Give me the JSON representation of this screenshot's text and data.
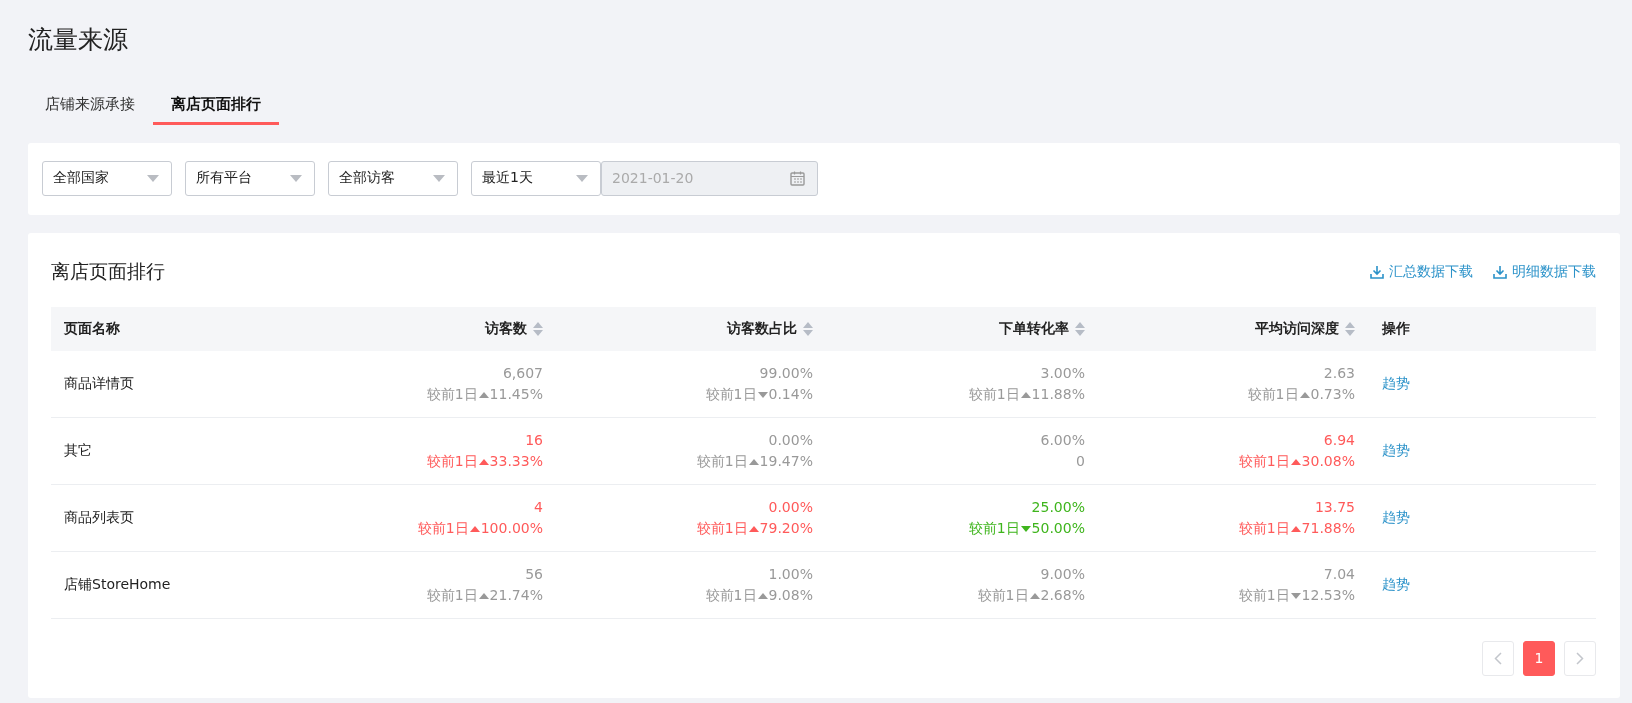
{
  "page_title": "流量来源",
  "tabs": [
    {
      "label": "店铺来源承接",
      "selected": false
    },
    {
      "label": "离店页面排行",
      "selected": true
    }
  ],
  "filters": [
    {
      "kind": "select",
      "value": "全部国家"
    },
    {
      "kind": "select",
      "value": "所有平台"
    },
    {
      "kind": "select",
      "value": "全部访客"
    },
    {
      "kind": "select",
      "value": "最近1天"
    },
    {
      "kind": "date",
      "value": "2021-01-20",
      "disabled": true
    }
  ],
  "ranking": {
    "title": "离店页面排行",
    "downloads": [
      "汇总数据下载",
      "明细数据下载"
    ],
    "columns": [
      {
        "label": "页面名称",
        "sortable": false
      },
      {
        "label": "访客数",
        "sortable": true
      },
      {
        "label": "访客数占比",
        "sortable": true
      },
      {
        "label": "下单转化率",
        "sortable": true
      },
      {
        "label": "平均访问深度",
        "sortable": true
      },
      {
        "label": "操作",
        "sortable": false
      }
    ],
    "rows": [
      {
        "name": "商品详情页",
        "action": "趋势",
        "metrics": [
          {
            "value": "6,607",
            "color": "#999999",
            "compare": {
              "kind": "change",
              "label": "较前1日",
              "rising": true,
              "change": "11.45%"
            }
          },
          {
            "value": "99.00%",
            "color": "#999999",
            "compare": {
              "kind": "change",
              "label": "较前1日",
              "rising": false,
              "change": "0.14%"
            }
          },
          {
            "value": "3.00%",
            "color": "#999999",
            "compare": {
              "kind": "change",
              "label": "较前1日",
              "rising": true,
              "change": "11.88%"
            }
          },
          {
            "value": "2.63",
            "color": "#999999",
            "compare": {
              "kind": "change",
              "label": "较前1日",
              "rising": true,
              "change": "0.73%"
            }
          }
        ]
      },
      {
        "name": "其它",
        "action": "趋势",
        "metrics": [
          {
            "value": "16",
            "color": "#ff5a5a",
            "compare": {
              "kind": "change",
              "label": "较前1日",
              "rising": true,
              "change": "33.33%"
            }
          },
          {
            "value": "0.00%",
            "color": "#999999",
            "compare": {
              "kind": "change",
              "label": "较前1日",
              "rising": true,
              "change": "19.47%"
            }
          },
          {
            "value": "6.00%",
            "color": "#999999",
            "compare": {
              "kind": "plain",
              "text": "0"
            }
          },
          {
            "value": "6.94",
            "color": "#ff5a5a",
            "compare": {
              "kind": "change",
              "label": "较前1日",
              "rising": true,
              "change": "30.08%"
            }
          }
        ]
      },
      {
        "name": "商品列表页",
        "action": "趋势",
        "metrics": [
          {
            "value": "4",
            "color": "#ff5a5a",
            "compare": {
              "kind": "change",
              "label": "较前1日",
              "rising": true,
              "change": "100.00%"
            }
          },
          {
            "value": "0.00%",
            "color": "#ff5a5a",
            "compare": {
              "kind": "change",
              "label": "较前1日",
              "rising": true,
              "change": "79.20%"
            }
          },
          {
            "value": "25.00%",
            "color": "#3fb51d",
            "compare": {
              "kind": "change",
              "label": "较前1日",
              "rising": false,
              "change": "50.00%"
            }
          },
          {
            "value": "13.75",
            "color": "#ff5a5a",
            "compare": {
              "kind": "change",
              "label": "较前1日",
              "rising": true,
              "change": "71.88%"
            }
          }
        ]
      },
      {
        "name": "店铺StoreHome",
        "action": "趋势",
        "metrics": [
          {
            "value": "56",
            "color": "#999999",
            "compare": {
              "kind": "change",
              "label": "较前1日",
              "rising": true,
              "change": "21.74%"
            }
          },
          {
            "value": "1.00%",
            "color": "#999999",
            "compare": {
              "kind": "change",
              "label": "较前1日",
              "rising": true,
              "change": "9.08%"
            }
          },
          {
            "value": "9.00%",
            "color": "#999999",
            "compare": {
              "kind": "change",
              "label": "较前1日",
              "rising": true,
              "change": "2.68%"
            }
          },
          {
            "value": "7.04",
            "color": "#999999",
            "compare": {
              "kind": "change",
              "label": "较前1日",
              "rising": false,
              "change": "12.53%"
            }
          }
        ]
      }
    ],
    "pagination": {
      "pages": [
        {
          "label": "1",
          "selected": true
        }
      ]
    }
  }
}
